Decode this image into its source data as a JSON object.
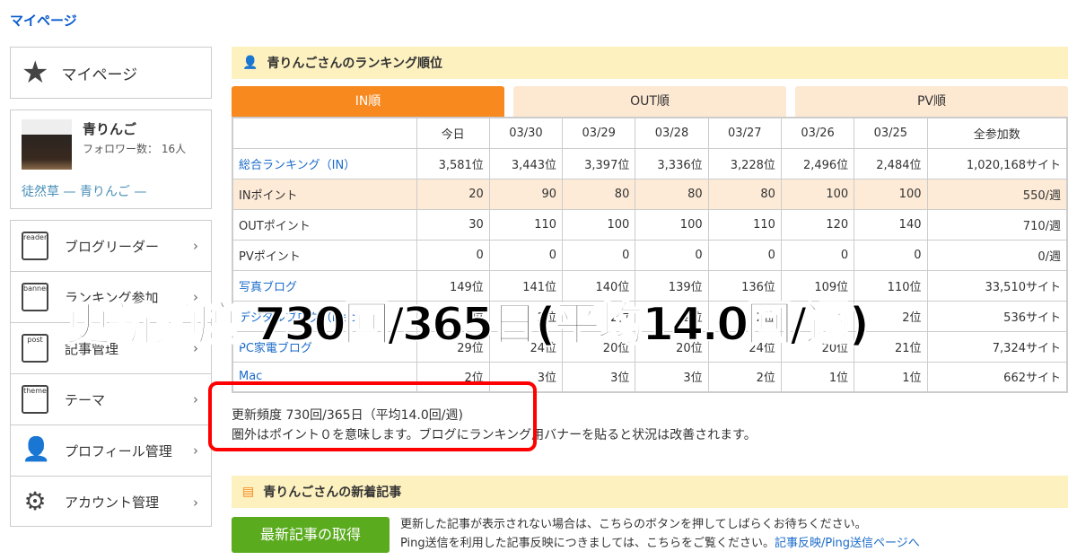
{
  "breadcrumb": "マイページ",
  "sidebar": {
    "mypage": "マイページ",
    "profile": {
      "name": "青りんご",
      "followers": "フォロワー数： 16人",
      "blog": "徒然草 — 青りんご —"
    },
    "items": [
      {
        "icon": "reader",
        "label": "ブログリーダー"
      },
      {
        "icon": "banner",
        "label": "ランキング参加"
      },
      {
        "icon": "post",
        "label": "記事管理"
      },
      {
        "icon": "theme",
        "label": "テーマ"
      },
      {
        "icon": "person-gear",
        "label": "プロフィール管理"
      },
      {
        "icon": "gear",
        "label": "アカウント管理"
      }
    ]
  },
  "ranking": {
    "title": "青りんごさんのランキング順位",
    "tabs": [
      "IN順",
      "OUT順",
      "PV順"
    ],
    "headers": [
      "",
      "今日",
      "03/30",
      "03/29",
      "03/28",
      "03/27",
      "03/26",
      "03/25",
      "全参加数"
    ],
    "rows": [
      [
        "総合ランキング（IN）",
        "3,581位",
        "3,443位",
        "3,397位",
        "3,336位",
        "3,228位",
        "2,496位",
        "2,484位",
        "1,020,168サイト"
      ],
      [
        "INポイント",
        "20",
        "90",
        "80",
        "80",
        "80",
        "100",
        "100",
        "550/週"
      ],
      [
        "OUTポイント",
        "30",
        "110",
        "100",
        "100",
        "110",
        "120",
        "140",
        "710/週"
      ],
      [
        "PVポイント",
        "0",
        "0",
        "0",
        "0",
        "0",
        "0",
        "0",
        "0/週"
      ],
      [
        "写真ブログ",
        "149位",
        "141位",
        "140位",
        "139位",
        "136位",
        "109位",
        "110位",
        "33,510サイト"
      ],
      [
        "デジタルブログ（Mac）",
        "2位",
        "2位",
        "2位",
        "2位",
        "2位",
        "2位",
        "2位",
        "536サイト"
      ],
      [
        "PC家電ブログ",
        "29位",
        "24位",
        "20位",
        "20位",
        "24位",
        "20位",
        "21位",
        "7,324サイト"
      ],
      [
        "Mac",
        "2位",
        "3位",
        "3位",
        "3位",
        "2位",
        "1位",
        "1位",
        "662サイト"
      ]
    ],
    "note1": "更新頻度 730回/365日（平均14.0回/週)",
    "note2": "圏外はポイント０を意味します。ブログにランキング用バナーを貼ると状況は改善されます。"
  },
  "overlay": "更新頻度 730回/365日(平均14.0回/週)",
  "articles": {
    "title": "青りんごさんの新着記事",
    "button": "最新記事の取得",
    "msg1": "更新した記事が表示されない場合は、こちらのボタンを押してしばらくお待ちください。",
    "msg2": "Ping送信を利用した記事反映につきましては、こちらをご覧ください。",
    "link": "記事反映/Ping送信ページへ"
  },
  "colors": {
    "accent": "#f7891f",
    "link": "#1a6bc9",
    "button": "#5aab1e",
    "highlight": "#ff0000"
  }
}
